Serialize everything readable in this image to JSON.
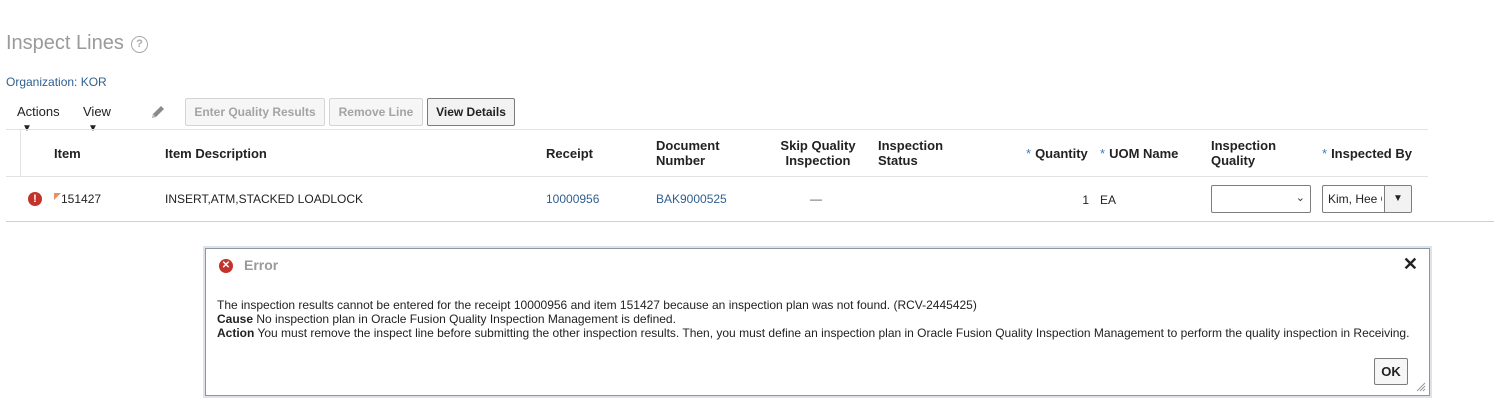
{
  "page": {
    "title": "Inspect Lines",
    "organization": "Organization: KOR"
  },
  "toolbar": {
    "actions_label": "Actions",
    "view_label": "View",
    "enter_quality_results": "Enter Quality Results",
    "remove_line": "Remove Line",
    "view_details": "View Details"
  },
  "table": {
    "headers": {
      "item": "Item",
      "item_description": "Item Description",
      "receipt": "Receipt",
      "document_number_1": "Document",
      "document_number_2": "Number",
      "skip_quality_1": "Skip Quality",
      "skip_quality_2": "Inspection",
      "inspection_status_1": "Inspection",
      "inspection_status_2": "Status",
      "quantity": "Quantity",
      "uom_name": "UOM Name",
      "inspection_quality_1": "Inspection",
      "inspection_quality_2": "Quality",
      "inspected_by": "Inspected By",
      "required_marker": "*"
    },
    "row": {
      "item": "151427",
      "item_description": "INSERT,ATM,STACKED LOADLOCK",
      "receipt": "10000956",
      "document_number": "BAK9000525",
      "skip_quality_inspection": "—",
      "inspection_status": "",
      "quantity": "1",
      "uom_name": "EA",
      "inspection_quality": "",
      "inspected_by": "Kim, Hee C"
    }
  },
  "dialog": {
    "title": "Error",
    "message": "The inspection results cannot be entered for the receipt 10000956 and item 151427 because an inspection plan was not found. (RCV-2445425)",
    "cause_label": "Cause",
    "cause_text": " No inspection plan in Oracle Fusion Quality Inspection Management is defined.",
    "action_label": "Action",
    "action_text": " You must remove the inspect line before submitting the other inspection results. Then, you must define an inspection plan in Oracle Fusion Quality Inspection Management to perform the quality inspection in Receiving.",
    "ok_label": "OK"
  },
  "icons": {
    "help": "help-circle-icon",
    "edit": "pencil-icon",
    "row_error": "exclamation-circle-icon",
    "dialog_error": "x-circle-icon",
    "close": "close-icon"
  },
  "colors": {
    "link": "#2f5f8f",
    "error": "#c3322b",
    "required": "#3a7cc3"
  }
}
